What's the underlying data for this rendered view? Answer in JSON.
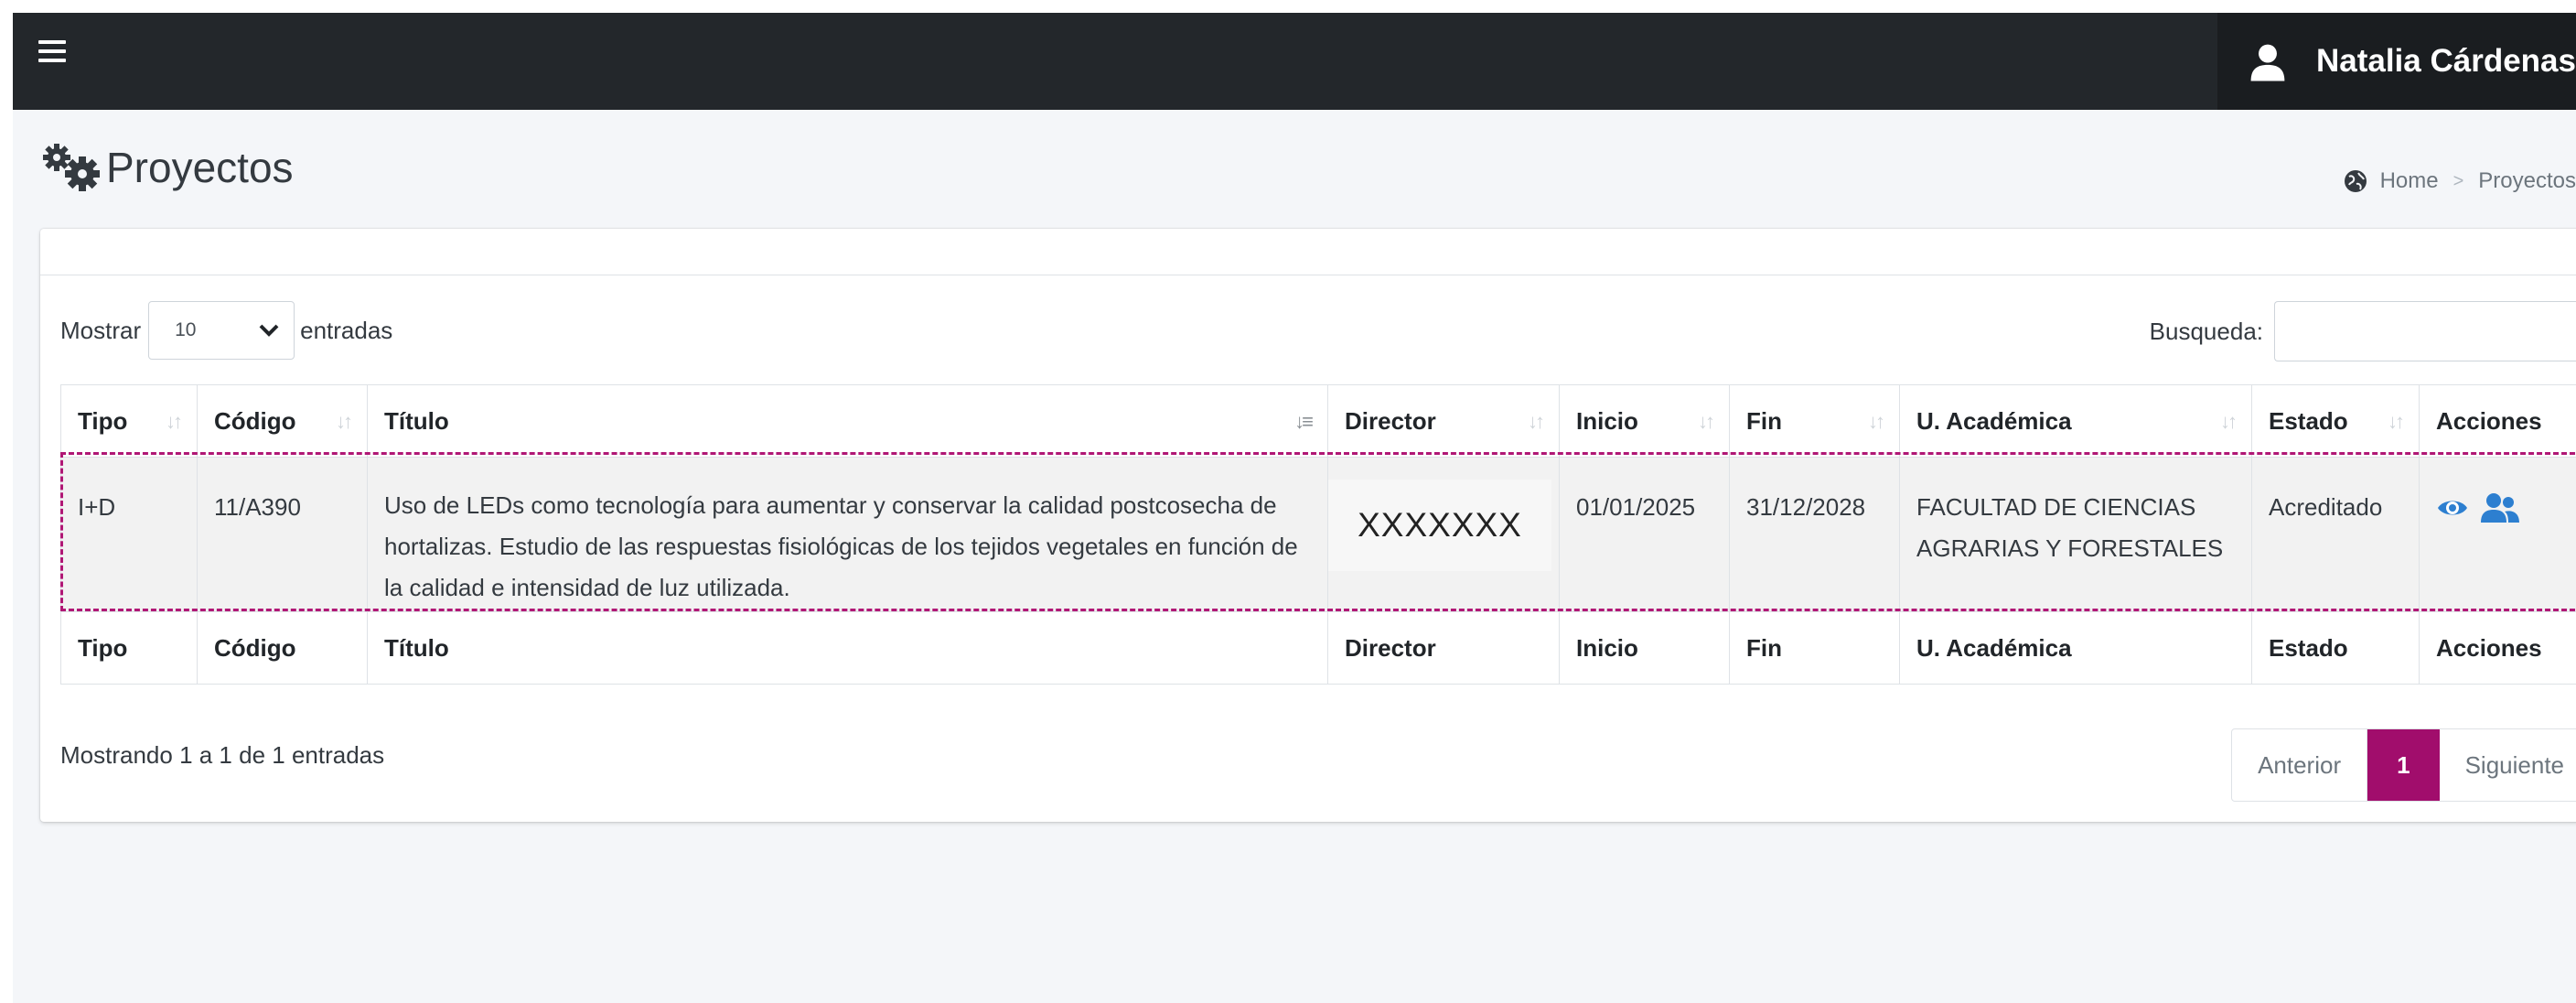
{
  "topbar": {
    "user_name": "Natalia Cárdenas"
  },
  "header": {
    "title": "Proyectos",
    "breadcrumb": [
      "Home",
      "Proyectos"
    ],
    "breadcrumb_sep": ">"
  },
  "length_control": {
    "label_before": "Mostrar",
    "value": "10",
    "label_after": "entradas"
  },
  "search": {
    "label": "Busqueda:",
    "value": ""
  },
  "table": {
    "columns": [
      "Tipo",
      "Código",
      "Título",
      "Director",
      "Inicio",
      "Fin",
      "U. Académica",
      "Estado",
      "Acciones"
    ],
    "rows": [
      {
        "tipo": "I+D",
        "codigo": "11/A390",
        "titulo": "Uso de LEDs como tecnología para aumentar y conservar la calidad postcosecha de hortalizas. Estudio de las respuestas fisiológicas de los tejidos vegetales en función de la calidad e intensidad de luz utilizada.",
        "director": "XXXXXXX",
        "inicio": "01/01/2025",
        "fin": "31/12/2028",
        "unidad": "FACULTAD DE CIENCIAS AGRARIAS Y FORESTALES",
        "estado": "Acreditado",
        "actions": [
          "eye-icon",
          "users-icon"
        ]
      }
    ]
  },
  "footer": {
    "info": "Mostrando 1 a 1 de 1 entradas",
    "pager": {
      "prev": "Anterior",
      "current": "1",
      "next": "Siguiente"
    }
  },
  "colors": {
    "navbar": "#23272b",
    "accent": "#a10d6c",
    "action_icon": "#2d7fd0",
    "highlight_outline": "#b01775"
  },
  "icons": [
    "menu-icon",
    "user-icon",
    "gears-icon",
    "globe-icon",
    "sort-icon",
    "chevron-down-icon",
    "eye-icon",
    "users-icon"
  ]
}
